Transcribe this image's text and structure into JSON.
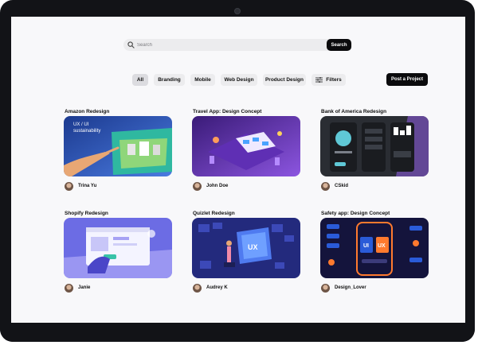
{
  "search": {
    "placeholder": "Search",
    "button_label": "Search"
  },
  "filters": [
    {
      "label": "All",
      "active": true
    },
    {
      "label": "Branding",
      "active": false
    },
    {
      "label": "Mobile",
      "active": false
    },
    {
      "label": "Web Design",
      "active": false
    },
    {
      "label": "Product Design",
      "active": false
    },
    {
      "label": "Filters",
      "active": false,
      "icon": "sliders-icon"
    }
  ],
  "post_project_label": "Post a Project",
  "cards": [
    {
      "title": "Amazon Redesign",
      "author": "Trina Yu",
      "thumb_text": [
        "UX / UI",
        "sustainability"
      ],
      "palette": [
        "#1e3a7a",
        "#3f6bd6"
      ]
    },
    {
      "title": "Travel App: Design Concept",
      "author": "John Doe",
      "palette": [
        "#3b1f7a",
        "#7d4bd9"
      ]
    },
    {
      "title": "Bank of America Redesign",
      "author": "CSkid",
      "palette": [
        "#2e3036",
        "#5aa8c9"
      ]
    },
    {
      "title": "Shopify Redesign",
      "author": "Janie",
      "palette": [
        "#6f6fe6",
        "#a7a2f4"
      ]
    },
    {
      "title": "Quizlet Redesign",
      "author": "Audrey K",
      "thumb_text": [
        "UX"
      ],
      "palette": [
        "#232a7d",
        "#3c49b8"
      ]
    },
    {
      "title": "Safety app: Design Concept",
      "author": "Design_Lover",
      "thumb_text": [
        "UI",
        "UX"
      ],
      "palette": [
        "#14143c",
        "#ff7a2e"
      ]
    }
  ]
}
